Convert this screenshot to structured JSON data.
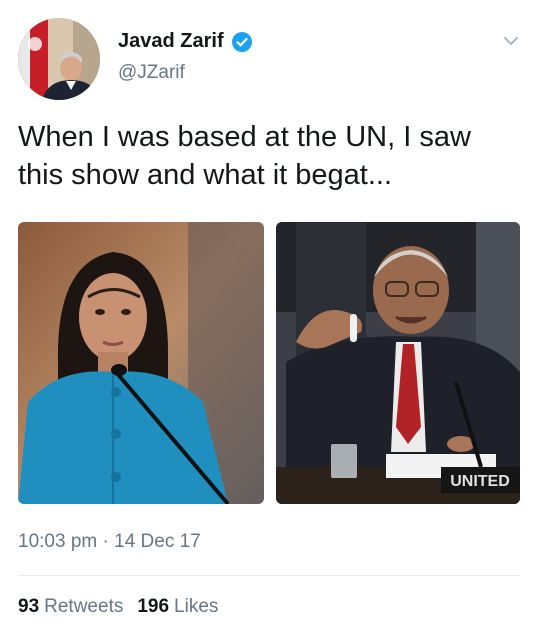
{
  "author": {
    "display_name": "Javad Zarif",
    "handle": "@JZarif"
  },
  "tweet": {
    "text": "When I was based at the UN, I saw this show and what it begat...",
    "time": "10:03 pm",
    "separator": "·",
    "date": "14 Dec 17"
  },
  "media": {
    "right_sign": "UNITED"
  },
  "stats": {
    "retweets_count": "93",
    "retweets_label": "Retweets",
    "likes_count": "196",
    "likes_label": "Likes"
  },
  "colors": {
    "verified": "#1da1f2",
    "muted_text": "#657786",
    "primary_text": "#14171a"
  },
  "icons": [
    "verified-badge-icon",
    "chevron-down-icon"
  ]
}
